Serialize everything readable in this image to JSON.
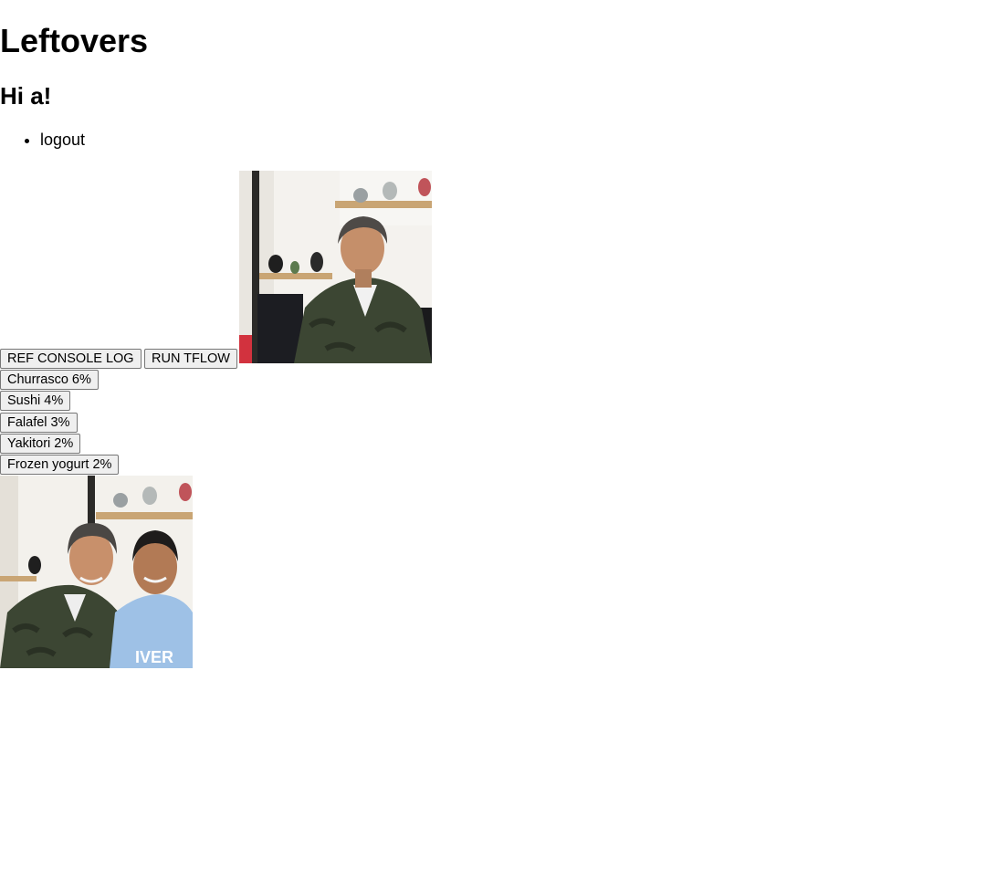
{
  "header": {
    "title": "Leftovers",
    "greeting": "Hi a!"
  },
  "nav": {
    "items": [
      {
        "label": "logout"
      }
    ]
  },
  "controls": {
    "ref_console_log_label": "REF CONSOLE LOG",
    "run_tflow_label": "RUN TFLOW"
  },
  "predictions": [
    {
      "label": "Churrasco 6%"
    },
    {
      "label": "Sushi 4%"
    },
    {
      "label": "Falafel 3%"
    },
    {
      "label": "Yakitori 2%"
    },
    {
      "label": "Frozen yogurt 2%"
    }
  ],
  "images": {
    "webcam_feed": "webcam-photo",
    "captured": "captured-photo"
  }
}
